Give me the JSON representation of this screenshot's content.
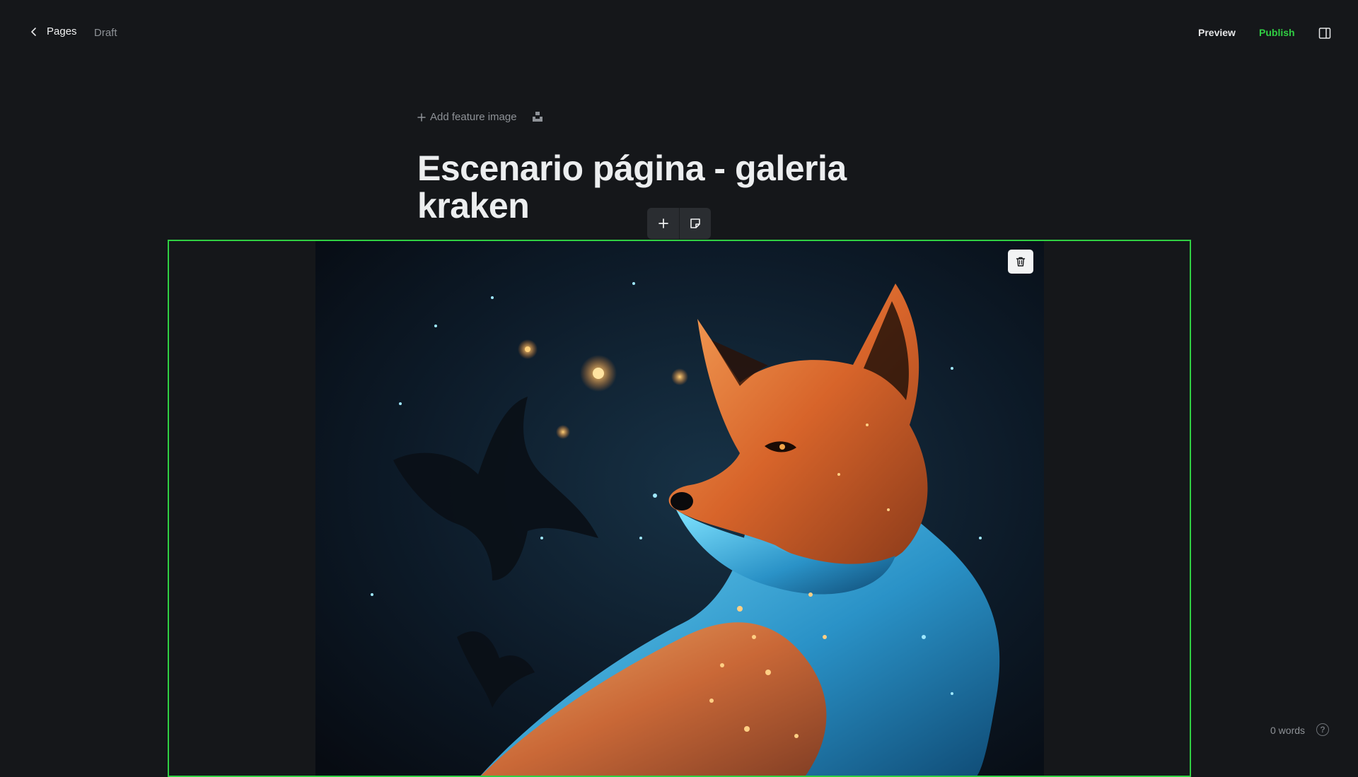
{
  "header": {
    "back_label": "Pages",
    "status": "Draft",
    "preview_label": "Preview",
    "publish_label": "Publish",
    "accent_color": "#30cf43"
  },
  "editor": {
    "feature_image_label": "Add feature image",
    "title_line1": "Escenario página - galeria",
    "title_line2": "kraken",
    "card_toolbar_icons": [
      "plus-icon",
      "snippet-icon"
    ],
    "image_subject": "glowing cosmic fox"
  },
  "footer": {
    "word_count": "0 words",
    "help_symbol": "?"
  },
  "icons": [
    "chevron-left-icon",
    "sidebar-toggle-icon",
    "plus-icon",
    "unsplash-icon",
    "trash-icon",
    "help-icon"
  ]
}
